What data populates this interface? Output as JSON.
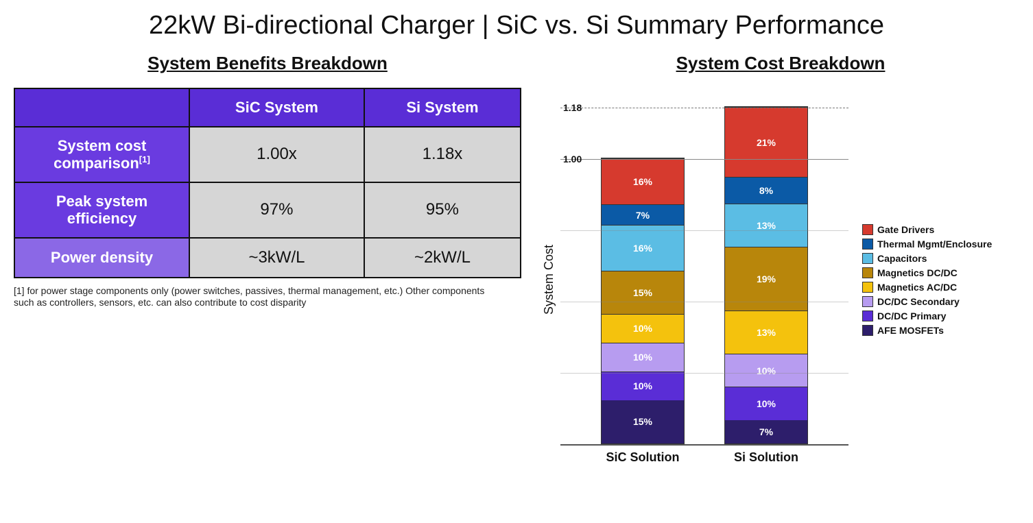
{
  "title": "22kW Bi-directional Charger | SiC vs. Si Summary Performance",
  "left": {
    "subtitle": "System Benefits Breakdown",
    "columns": [
      "SiC System",
      "Si System"
    ],
    "rows": [
      {
        "label": "System cost comparison",
        "sup": "[1]",
        "sic": "1.00x",
        "si": "1.18x",
        "shade": "dark"
      },
      {
        "label": "Peak system efficiency",
        "sup": "",
        "sic": "97%",
        "si": "95%",
        "shade": "dark"
      },
      {
        "label": "Power density",
        "sup": "",
        "sic": "~3kW/L",
        "si": "~2kW/L",
        "shade": "light"
      }
    ],
    "footnote": "[1] for power stage components only (power switches, passives, thermal management, etc.) Other components such as controllers, sensors, etc. can also contribute to cost disparity"
  },
  "right": {
    "subtitle": "System Cost Breakdown",
    "ylabel": "System Cost"
  },
  "chart_data": {
    "type": "bar-stacked",
    "ylabel": "System Cost",
    "ylim": [
      0,
      1.25
    ],
    "yticks": [
      {
        "v": 1.0,
        "label": "1.00"
      },
      {
        "v": 1.18,
        "label": "1.18",
        "dashed": true
      }
    ],
    "categories": [
      "SiC Solution",
      "Si Solution"
    ],
    "stack_order": [
      "AFE MOSFETs",
      "DC/DC Primary",
      "DC/DC Secondary",
      "Magnetics AC/DC",
      "Magnetics DC/DC",
      "Capacitors",
      "Thermal Mgmt/Enclosure",
      "Gate Drivers"
    ],
    "colors": {
      "AFE MOSFETs": "#2d1e6b",
      "DC/DC Primary": "#5a2dd6",
      "DC/DC Secondary": "#b79cf0",
      "Magnetics AC/DC": "#f4c20d",
      "Magnetics DC/DC": "#b8860b",
      "Capacitors": "#5bbde4",
      "Thermal Mgmt/Enclosure": "#0b5aa6",
      "Gate Drivers": "#d63a2e"
    },
    "series": [
      {
        "name": "SiC Solution",
        "total": 1.0,
        "values": {
          "AFE MOSFETs": 15,
          "DC/DC Primary": 10,
          "DC/DC Secondary": 10,
          "Magnetics AC/DC": 10,
          "Magnetics DC/DC": 15,
          "Capacitors": 16,
          "Thermal Mgmt/Enclosure": 7,
          "Gate Drivers": 16
        }
      },
      {
        "name": "Si Solution",
        "total": 1.18,
        "values": {
          "AFE MOSFETs": 7,
          "DC/DC Primary": 10,
          "DC/DC Secondary": 10,
          "Magnetics AC/DC": 13,
          "Magnetics DC/DC": 19,
          "Capacitors": 13,
          "Thermal Mgmt/Enclosure": 8,
          "Gate Drivers": 21
        }
      }
    ],
    "legend_order": [
      "Gate Drivers",
      "Thermal Mgmt/Enclosure",
      "Capacitors",
      "Magnetics DC/DC",
      "Magnetics AC/DC",
      "DC/DC Secondary",
      "DC/DC Primary",
      "AFE MOSFETs"
    ]
  }
}
